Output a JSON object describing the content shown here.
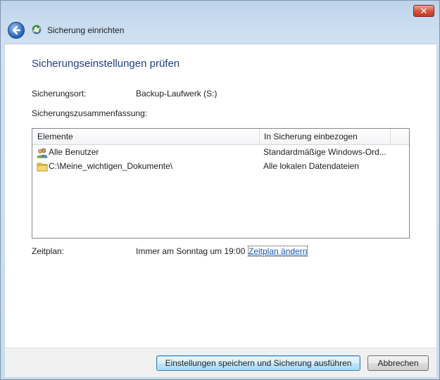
{
  "window": {
    "title": "Sicherung einrichten",
    "close_label": "✕"
  },
  "page": {
    "heading": "Sicherungseinstellungen prüfen",
    "backup_location_label": "Sicherungsort:",
    "backup_location_value": "Backup-Laufwerk (S:)",
    "summary_label": "Sicherungszusammenfassung:",
    "schedule_label": "Zeitplan:",
    "schedule_value": "Immer am Sonntag um 19:00",
    "change_schedule_link": "Zeitplan ändern"
  },
  "summary_list": {
    "columns": [
      "Elemente",
      "In Sicherung einbezogen"
    ],
    "rows": [
      {
        "icon": "users-icon",
        "item": "Alle Benutzer",
        "included": "Standardmäßige Windows-Ord..."
      },
      {
        "icon": "folder-icon",
        "item": "C:\\Meine_wichtigen_Dokumente\\",
        "included": "Alle lokalen Datendateien"
      }
    ]
  },
  "footer": {
    "save_run_label": "Einstellungen speichern und Sicherung ausführen",
    "cancel_label": "Abbrechen"
  },
  "colors": {
    "heading": "#1f3f86",
    "link": "#1a5bb5",
    "close": "#c23c22"
  }
}
